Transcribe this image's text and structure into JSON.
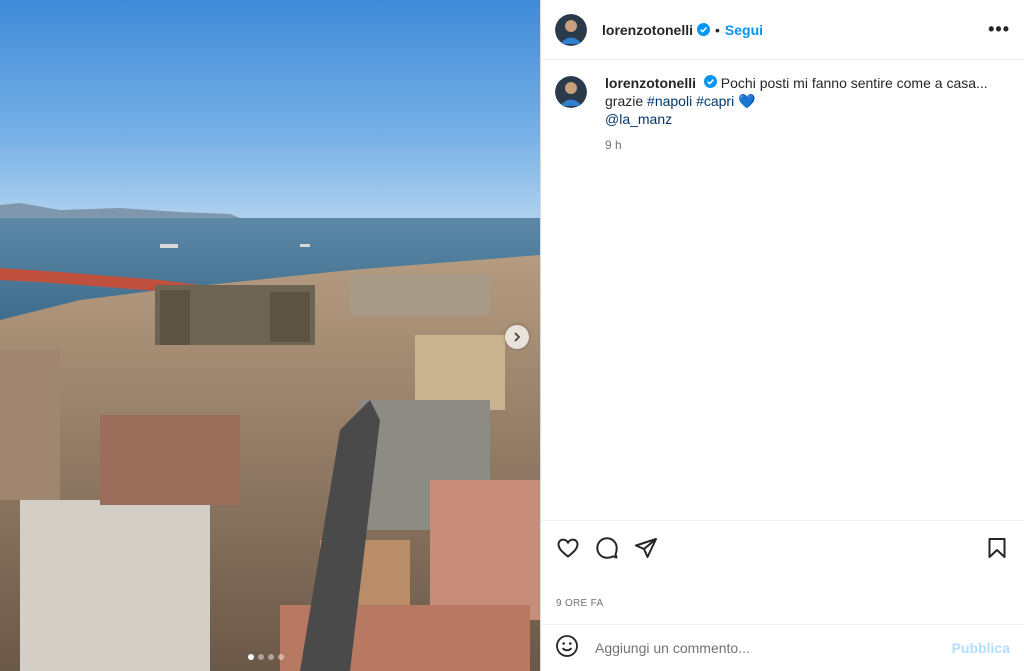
{
  "post": {
    "username": "lorenzotonelli",
    "separator": "•",
    "follow_label": "Segui",
    "more_label": "•••",
    "caption": {
      "line1": "Pochi posti mi fanno sentire come a casa...",
      "line2_prefix": "grazie",
      "hashtags": [
        "#napoli",
        "#capri"
      ],
      "emoji": "💙",
      "mention": "@la_manz",
      "time": "9 h"
    },
    "date_label": "9 ORE FA",
    "comment": {
      "placeholder": "Aggiungi un commento...",
      "publish_label": "Pubblica"
    },
    "carousel": {
      "slide_count": 4,
      "active_slide": 1
    }
  },
  "colors": {
    "accent": "#0095f6",
    "verified": "#0095f6",
    "link": "#00376b",
    "publish_disabled": "#b2dffc"
  }
}
